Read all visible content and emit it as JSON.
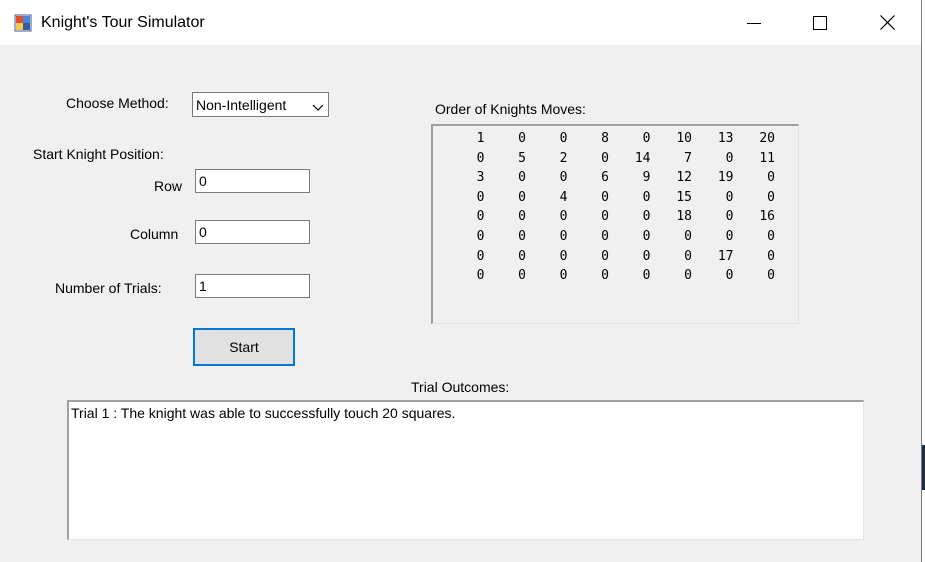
{
  "window": {
    "title": "Knight's Tour Simulator",
    "icon": "app-icon"
  },
  "controls": {
    "method_label": "Choose Method:",
    "method_value": "Non-Intelligent",
    "start_position_label": "Start Knight Position:",
    "row_label": "Row",
    "row_value": "0",
    "column_label": "Column",
    "column_value": "0",
    "trials_label": "Number of Trials:",
    "trials_value": "1",
    "start_button": "Start"
  },
  "moves": {
    "label": "Order of Knights Moves:",
    "rows": [
      [
        "1",
        "0",
        "0",
        "8",
        "0",
        "10",
        "13",
        "20"
      ],
      [
        "0",
        "5",
        "2",
        "0",
        "14",
        "7",
        "0",
        "11"
      ],
      [
        "3",
        "0",
        "0",
        "6",
        "9",
        "12",
        "19",
        "0"
      ],
      [
        "0",
        "0",
        "4",
        "0",
        "0",
        "15",
        "0",
        "0"
      ],
      [
        "0",
        "0",
        "0",
        "0",
        "0",
        "18",
        "0",
        "16"
      ],
      [
        "0",
        "0",
        "0",
        "0",
        "0",
        "0",
        "0",
        "0"
      ],
      [
        "0",
        "0",
        "0",
        "0",
        "0",
        "0",
        "17",
        "0"
      ],
      [
        "0",
        "0",
        "0",
        "0",
        "0",
        "0",
        "0",
        "0"
      ]
    ]
  },
  "outcomes": {
    "label": "Trial Outcomes:",
    "lines": [
      "Trial 1 : The knight was able to successfully touch 20 squares."
    ]
  }
}
